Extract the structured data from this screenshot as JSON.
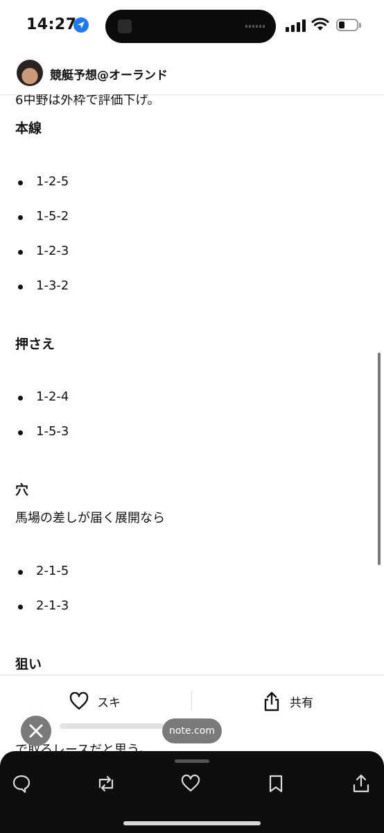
{
  "status_bar": {
    "time": "14:27"
  },
  "account": {
    "name": "競艇予想@オーランド"
  },
  "article": {
    "cut_line": "6中野は外枠で評価下げ。",
    "sections": [
      {
        "heading": "本線",
        "items": [
          "1-2-5",
          "1-5-2",
          "1-2-3",
          "1-3-2"
        ]
      },
      {
        "heading": "押さえ",
        "items": [
          "1-2-4",
          "1-5-3"
        ]
      },
      {
        "heading": "穴",
        "text": "馬場の差しが届く展開なら",
        "items": [
          "2-1-5",
          "2-1-3"
        ]
      },
      {
        "heading": "狙い"
      }
    ],
    "behind_text": "で取るレースだと思う。"
  },
  "action_bar": {
    "like_label": "スキ",
    "share_label": "共有"
  },
  "overlay": {
    "domain_pill": "note.com"
  },
  "icons": {
    "location": "location-arrow-icon",
    "like": "heart-icon",
    "share": "share-icon",
    "close": "close-icon",
    "toolbar": [
      "comment-icon",
      "repost-icon",
      "heart-icon",
      "bookmark-icon",
      "share-icon"
    ]
  },
  "colors": {
    "accent_blue": "#1d7bf2",
    "bottom_bar": "#0e0e0e",
    "pill": "#7a7a7a"
  }
}
